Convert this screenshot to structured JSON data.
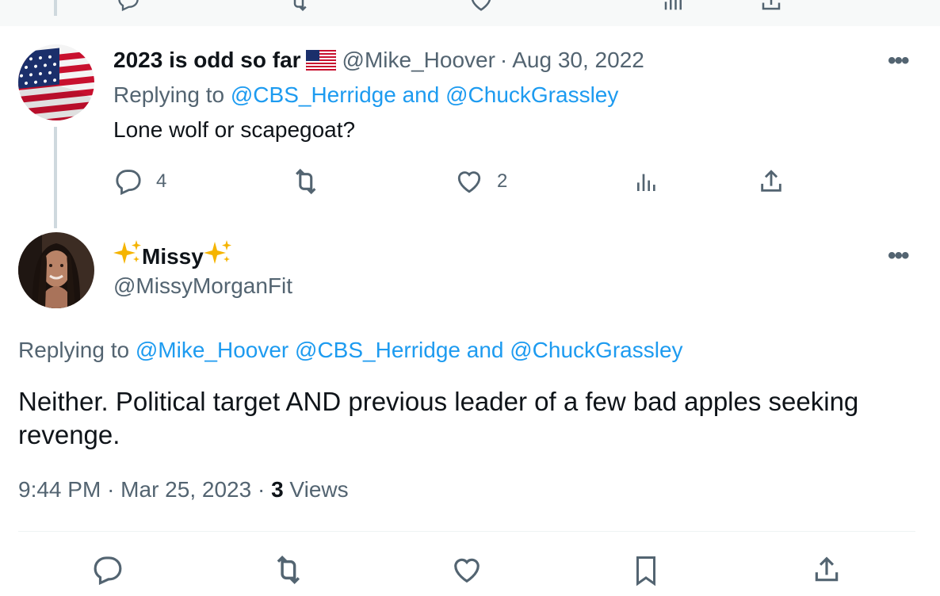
{
  "reply_tweet": {
    "display_name": "2023 is odd so far",
    "flag_emoji_name": "us-flag-emoji",
    "handle": "@Mike_Hoover",
    "separator": "·",
    "date": "Aug 30, 2022",
    "replying_to_prefix": "Replying to",
    "replying_to_accounts": "@CBS_Herridge and @ChuckGrassley",
    "text": "Lone wolf or scapegoat?",
    "reply_count": "4",
    "like_count": "2",
    "more_label": "•••"
  },
  "main_tweet": {
    "display_name": "Missy",
    "name_decoration": "sparkles-emoji",
    "handle": "@MissyMorganFit",
    "replying_to_prefix": "Replying to",
    "replying_to_accounts": "@Mike_Hoover @CBS_Herridge and @ChuckGrassley",
    "text": "Neither. Political target AND previous leader of a few bad apples seeking revenge.",
    "time": "9:44 PM",
    "separator": "·",
    "date": "Mar 25, 2023",
    "views_count": "3",
    "views_label": "Views",
    "more_label": "•••"
  },
  "colors": {
    "link_blue": "#1d9bf0",
    "secondary_text": "#536471",
    "primary_text": "#0f1419",
    "thread_line": "#cfd9de"
  }
}
